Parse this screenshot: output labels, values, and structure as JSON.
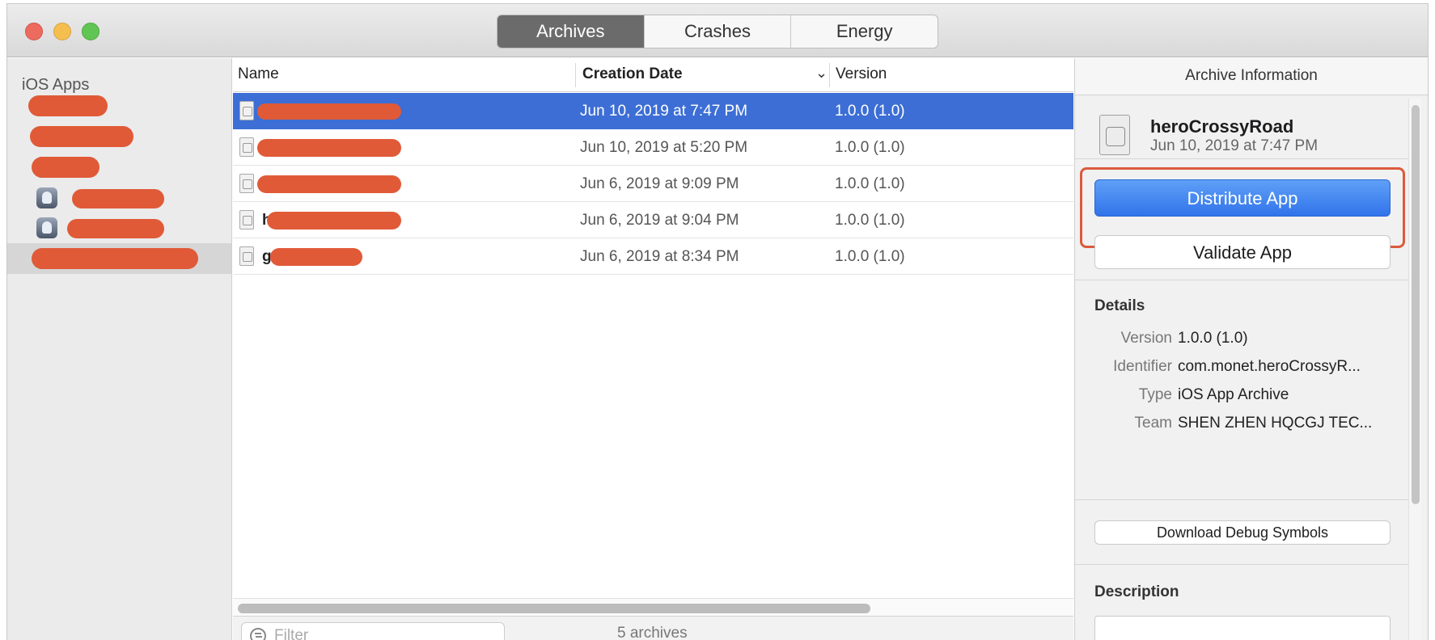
{
  "titlebar": {
    "tabs": [
      {
        "label": "Archives",
        "active": true
      },
      {
        "label": "Crashes",
        "active": false
      },
      {
        "label": "Energy",
        "active": false
      }
    ]
  },
  "sidebar": {
    "title": "iOS Apps",
    "items_count_visible": 6,
    "selected_index": 5
  },
  "table": {
    "columns": [
      "Name",
      "Creation Date",
      "Version"
    ],
    "sort_column": "Creation Date",
    "rows": [
      {
        "name_initial": "",
        "date": "Jun 10, 2019 at 7:47 PM",
        "version": "1.0.0 (1.0)",
        "selected": true
      },
      {
        "name_initial": "",
        "date": "Jun 10, 2019 at 5:20 PM",
        "version": "1.0.0 (1.0)",
        "selected": false
      },
      {
        "name_initial": "",
        "date": "Jun 6, 2019 at 9:09 PM",
        "version": "1.0.0 (1.0)",
        "selected": false
      },
      {
        "name_initial": "h",
        "date": "Jun 6, 2019 at 9:04 PM",
        "version": "1.0.0 (1.0)",
        "selected": false
      },
      {
        "name_initial": "g",
        "date": "Jun 6, 2019 at 8:34 PM",
        "version": "1.0.0 (1.0)",
        "selected": false
      }
    ],
    "filter_placeholder": "Filter",
    "count_text": "5 archives"
  },
  "inspector": {
    "header": "Archive Information",
    "app_name": "heroCrossyRoad",
    "app_date": "Jun 10, 2019 at 7:47 PM",
    "distribute_label": "Distribute App",
    "validate_label": "Validate App",
    "details_title": "Details",
    "details": [
      {
        "label": "Version",
        "value": "1.0.0 (1.0)"
      },
      {
        "label": "Identifier",
        "value": "com.monet.heroCrossyR..."
      },
      {
        "label": "Type",
        "value": "iOS App Archive"
      },
      {
        "label": "Team",
        "value": "SHEN ZHEN HQCGJ TEC..."
      }
    ],
    "debug_symbols_label": "Download Debug Symbols",
    "description_title": "Description"
  },
  "colors": {
    "selection": "#3c6ed5",
    "primary_button": "#3173ea",
    "highlight": "#dc5a3c",
    "redaction": "#e05a38"
  }
}
